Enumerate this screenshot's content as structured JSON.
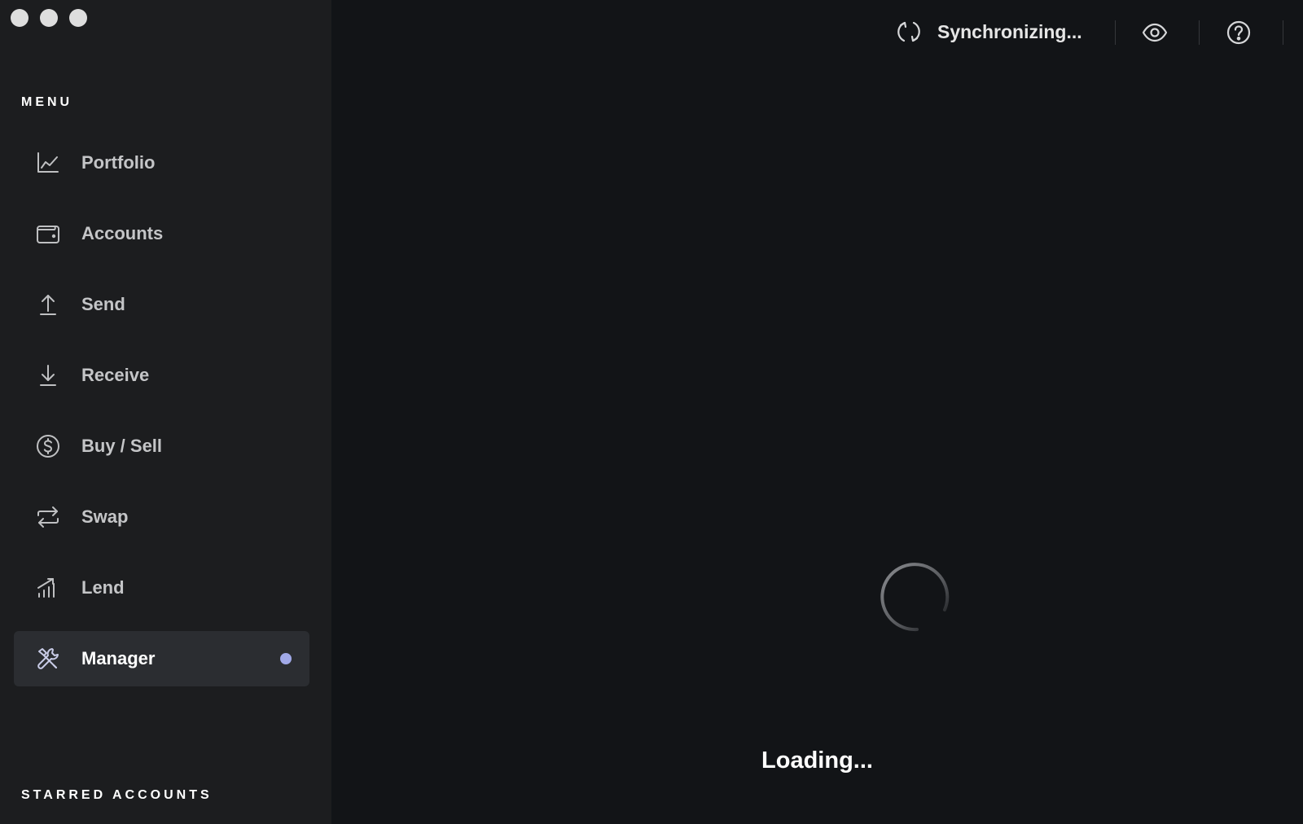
{
  "window": {
    "controls": [
      "close",
      "minimize",
      "maximize"
    ]
  },
  "sidebar": {
    "menu_title": "MENU",
    "starred_title": "STARRED ACCOUNTS",
    "items": [
      {
        "label": "Portfolio",
        "icon": "chart-line-icon",
        "active": false
      },
      {
        "label": "Accounts",
        "icon": "wallet-icon",
        "active": false
      },
      {
        "label": "Send",
        "icon": "arrow-up-icon",
        "active": false
      },
      {
        "label": "Receive",
        "icon": "arrow-down-icon",
        "active": false
      },
      {
        "label": "Buy / Sell",
        "icon": "dollar-circle-icon",
        "active": false
      },
      {
        "label": "Swap",
        "icon": "swap-arrows-icon",
        "active": false
      },
      {
        "label": "Lend",
        "icon": "bar-chart-icon",
        "active": false
      },
      {
        "label": "Manager",
        "icon": "tools-icon",
        "active": true,
        "badge_color": "#a1a9e8"
      }
    ]
  },
  "topbar": {
    "sync_label": "Synchronizing...",
    "sync_icon": "sync-icon",
    "eye_icon": "eye-icon",
    "help_icon": "help-circle-icon"
  },
  "main": {
    "loading_text": "Loading..."
  },
  "colors": {
    "sidebar_bg": "#1c1d1f",
    "main_bg": "#121417",
    "active_item_bg": "#2b2d31",
    "accent_dot": "#a1a9e8",
    "icon_color": "#bfc0c2"
  }
}
